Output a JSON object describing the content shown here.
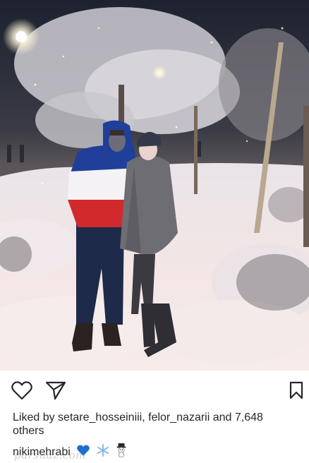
{
  "post": {
    "liked_by_prefix": "Liked by ",
    "liked_user_1": "setare_hosseiniii",
    "separator": ", ",
    "liked_user_2": "felor_nazarii",
    "and_text": " and ",
    "others_count": "7,648",
    "others_text": "others",
    "caption_user": "nikimehrabi",
    "caption_emojis": [
      "blue-heart",
      "snowflake",
      "snowman"
    ]
  },
  "watermark": "parsnaz.com",
  "icons": {
    "like": "heart-icon",
    "share": "send-icon",
    "save": "bookmark-icon"
  },
  "colors": {
    "text": "#262626",
    "heart_emoji": "#1f6fd1"
  }
}
